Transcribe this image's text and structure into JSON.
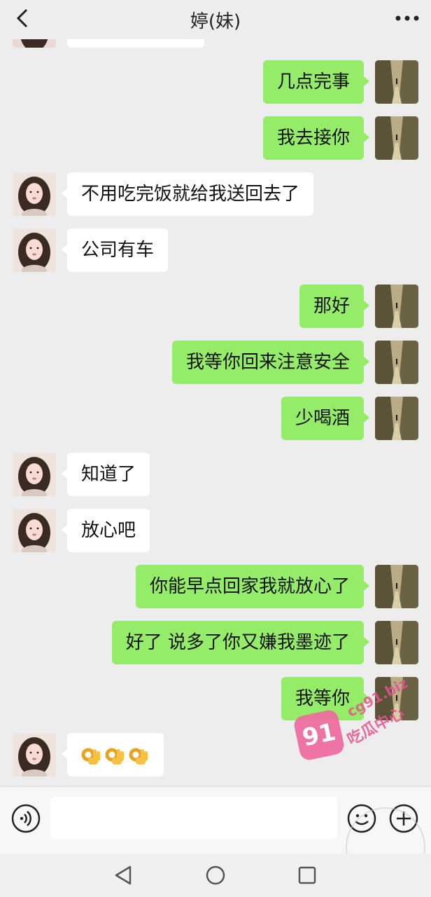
{
  "header": {
    "title": "婷(妹)"
  },
  "messages": [
    {
      "side": "right",
      "text": "几点完事"
    },
    {
      "side": "right",
      "text": "我去接你"
    },
    {
      "side": "left",
      "text": "不用吃完饭就给我送回去了"
    },
    {
      "side": "left",
      "text": "公司有车"
    },
    {
      "side": "right",
      "text": "那好"
    },
    {
      "side": "right",
      "text": "我等你回来注意安全"
    },
    {
      "side": "right",
      "text": "少喝酒"
    },
    {
      "side": "left",
      "text": "知道了"
    },
    {
      "side": "left",
      "text": "放心吧"
    },
    {
      "side": "right",
      "text": "你能早点回家我就放心了"
    },
    {
      "side": "right",
      "text": "好了 说多了你又嫌我墨迹了"
    },
    {
      "side": "right",
      "text": "我等你"
    },
    {
      "side": "left",
      "emoji": [
        "ok-hand-emoji",
        "ok-hand-emoji",
        "ok-hand-emoji"
      ]
    }
  ],
  "input": {
    "value": ""
  },
  "watermark": {
    "badge": "91",
    "site": "cg91.biz",
    "label": "吃瓜中心"
  },
  "colors": {
    "sent_bubble": "#95ec69",
    "received_bubble": "#ffffff",
    "background": "#ededed"
  }
}
